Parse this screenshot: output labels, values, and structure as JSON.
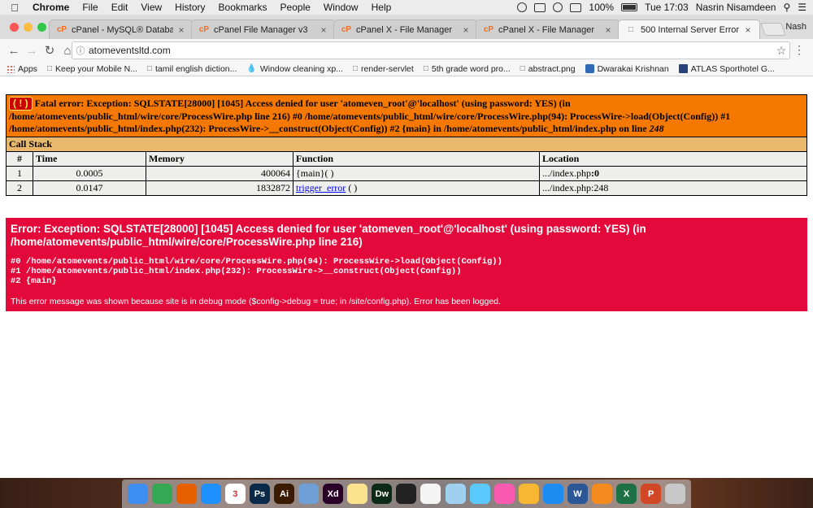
{
  "menubar": {
    "app_name": "Chrome",
    "items": [
      "File",
      "Edit",
      "View",
      "History",
      "Bookmarks",
      "People",
      "Window",
      "Help"
    ],
    "battery": "100%",
    "clock": "Tue 17:03",
    "user": "Nasrin Nisamdeen"
  },
  "tabs": [
    {
      "title": "cPanel - MySQL® Databases",
      "icon": "cpanel-icon"
    },
    {
      "title": "cPanel File Manager v3",
      "icon": "cpanel-icon"
    },
    {
      "title": "cPanel X - File Manager",
      "icon": "cpanel-icon"
    },
    {
      "title": "cPanel X - File Manager",
      "icon": "cpanel-icon"
    },
    {
      "title": "500 Internal Server Error",
      "icon": "document-icon"
    }
  ],
  "profile_name": "Nash",
  "address_bar": {
    "url": "atomeventsltd.com"
  },
  "bookmarks": [
    {
      "label": "Apps"
    },
    {
      "label": "Keep your Mobile N..."
    },
    {
      "label": "tamil english diction..."
    },
    {
      "label": "Window cleaning xp..."
    },
    {
      "label": "render-servlet"
    },
    {
      "label": "5th grade word pro..."
    },
    {
      "label": "abstract.png"
    },
    {
      "label": "Dwarakai Krishnan"
    },
    {
      "label": "ATLAS Sporthotel G..."
    }
  ],
  "xdebug": {
    "icon_text": "( ! )",
    "fatal_message": "Fatal error: Exception: SQLSTATE[28000] [1045] Access denied for user 'atomeven_root'@'localhost' (using password: YES) (in /home/atomevents/public_html/wire/core/ProcessWire.php line 216) #0 /home/atomevents/public_html/wire/core/ProcessWire.php(94): ProcessWire->load(Object(Config)) #1 /home/atomevents/public_html/index.php(232): ProcessWire->__construct(Object(Config)) #2 {main} in /home/atomevents/public_html/index.php on line ",
    "fatal_line": "248",
    "call_stack_label": "Call Stack",
    "columns": [
      "#",
      "Time",
      "Memory",
      "Function",
      "Location"
    ],
    "rows": [
      {
        "num": "1",
        "time": "0.0005",
        "memory": "400064",
        "function": "{main}( )",
        "function_link": "",
        "location_prefix": ".../index.php",
        "location_line": ":0"
      },
      {
        "num": "2",
        "time": "0.0147",
        "memory": "1832872",
        "function": "",
        "function_link": "trigger_error",
        "function_suffix": " ( )",
        "location_prefix": ".../index.php",
        "location_line": ":248"
      }
    ]
  },
  "error_box": {
    "title": "Error: Exception: SQLSTATE[28000] [1045] Access denied for user 'atomeven_root'@'localhost' (using password: YES) (in /home/atomevents/public_html/wire/core/ProcessWire.php line 216)",
    "trace": [
      "#0 /home/atomevents/public_html/wire/core/ProcessWire.php(94): ProcessWire->load(Object(Config))",
      "#1 /home/atomevents/public_html/index.php(232): ProcessWire->__construct(Object(Config))",
      "#2 {main}"
    ],
    "note": "This error message was shown because site is in debug mode ($config->debug = true; in /site/config.php). Error has been logged."
  },
  "dock": {
    "apps": [
      {
        "name": "finder-icon",
        "color": "#3d8ef0",
        "label": ""
      },
      {
        "name": "chrome-icon",
        "color": "#34a853",
        "label": ""
      },
      {
        "name": "firefox-icon",
        "color": "#e66000",
        "label": ""
      },
      {
        "name": "safari-icon",
        "color": "#1e90ff",
        "label": ""
      },
      {
        "name": "calendar-icon",
        "color": "#ffffff",
        "label": "3"
      },
      {
        "name": "photoshop-icon",
        "color": "#0a2a4a",
        "label": "Ps"
      },
      {
        "name": "illustrator-icon",
        "color": "#3a1a00",
        "label": "Ai"
      },
      {
        "name": "preview-icon",
        "color": "#6e9fd6",
        "label": ""
      },
      {
        "name": "xd-icon",
        "color": "#2b0028",
        "label": "Xd"
      },
      {
        "name": "notes-icon",
        "color": "#fbe38e",
        "label": ""
      },
      {
        "name": "dreamweaver-icon",
        "color": "#0d2a16",
        "label": "Dw"
      },
      {
        "name": "final-cut-icon",
        "color": "#222222",
        "label": ""
      },
      {
        "name": "reminders-icon",
        "color": "#f4f4f4",
        "label": ""
      },
      {
        "name": "photos-app-icon",
        "color": "#9fd0f0",
        "label": ""
      },
      {
        "name": "messages-icon",
        "color": "#5ac8fa",
        "label": ""
      },
      {
        "name": "itunes-icon",
        "color": "#fa5bb0",
        "label": ""
      },
      {
        "name": "photos-icon",
        "color": "#f7b733",
        "label": ""
      },
      {
        "name": "app-store-icon",
        "color": "#1c8cf2",
        "label": ""
      },
      {
        "name": "word-icon",
        "color": "#2b5797",
        "label": "W"
      },
      {
        "name": "ibooks-icon",
        "color": "#f58b1f",
        "label": ""
      },
      {
        "name": "excel-icon",
        "color": "#1e7145",
        "label": "X"
      },
      {
        "name": "powerpoint-icon",
        "color": "#d24726",
        "label": "P"
      },
      {
        "name": "trash-icon",
        "color": "#c8c8c8",
        "label": ""
      }
    ]
  }
}
